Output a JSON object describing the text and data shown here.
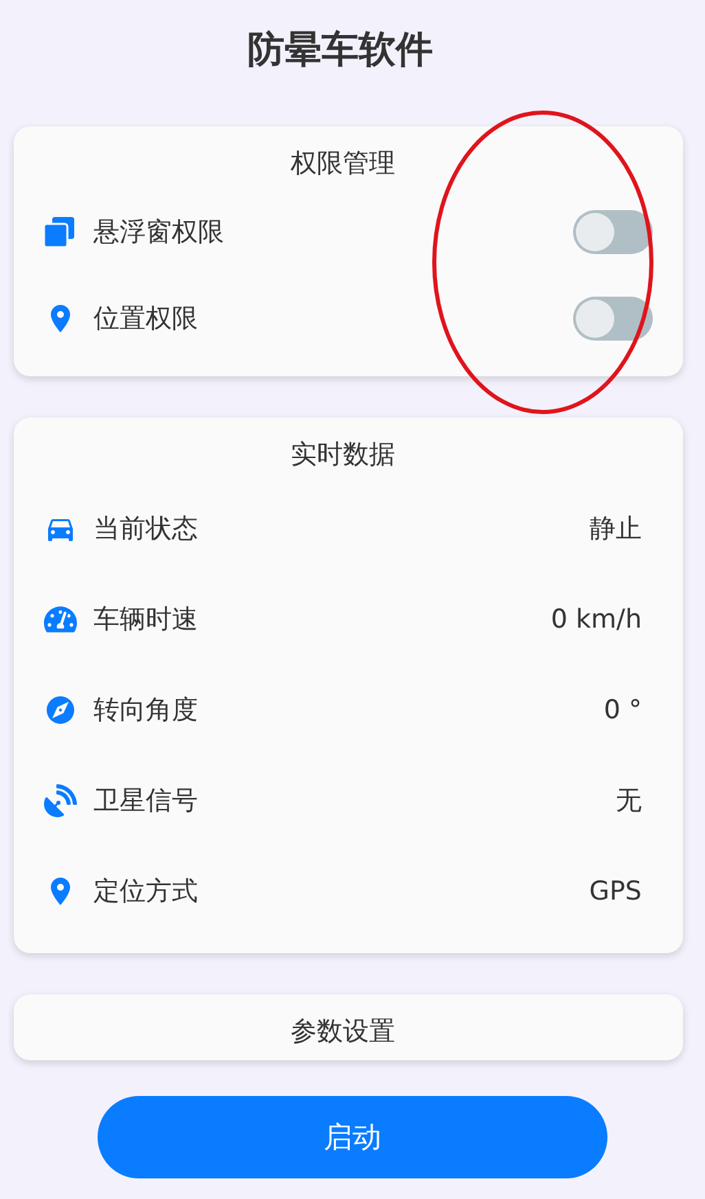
{
  "title": "防晕车软件",
  "permissions": {
    "title": "权限管理",
    "items": [
      {
        "label": "悬浮窗权限",
        "on": false
      },
      {
        "label": "位置权限",
        "on": false
      }
    ]
  },
  "realtime": {
    "title": "实时数据",
    "rows": [
      {
        "label": "当前状态",
        "value": "静止"
      },
      {
        "label": "车辆时速",
        "value": "0 km/h"
      },
      {
        "label": "转向角度",
        "value": "0 °"
      },
      {
        "label": "卫星信号",
        "value": "无"
      },
      {
        "label": "定位方式",
        "value": "GPS"
      }
    ]
  },
  "settings": {
    "title": "参数设置"
  },
  "start_button": "启动"
}
